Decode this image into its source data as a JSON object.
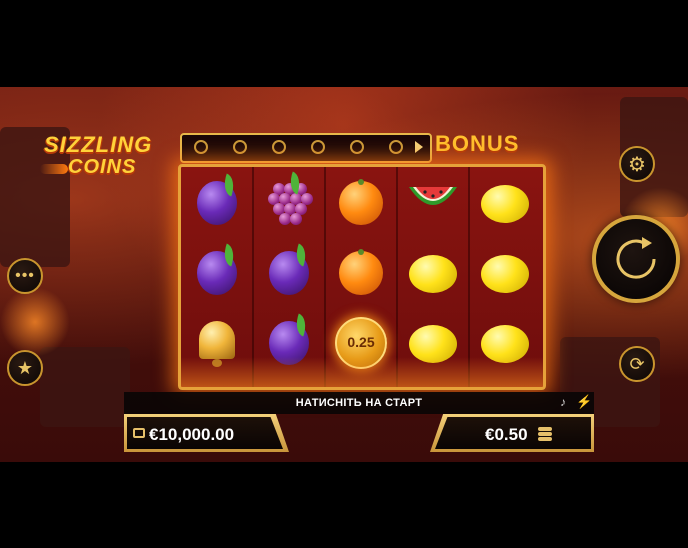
{
  "logo": {
    "line1": "SIZZLING",
    "line2": "COINS"
  },
  "bonus": {
    "label": "BONUS",
    "slots": 6
  },
  "reels": [
    [
      "plum",
      "plum",
      "bell"
    ],
    [
      "grapes",
      "plum",
      "plum"
    ],
    [
      "orange",
      "orange",
      "coin"
    ],
    [
      "watermelon",
      "lemon",
      "lemon"
    ],
    [
      "lemon",
      "lemon",
      "lemon"
    ]
  ],
  "coin_value": "0.25",
  "status": {
    "message": "НАТИСНІТЬ НА СТАРТ"
  },
  "balance": {
    "value": "€10,000.00"
  },
  "bet": {
    "value": "€0.50"
  },
  "icons": {
    "menu": "more-dots-icon",
    "favorite": "star-icon",
    "settings": "gear-icon",
    "spin": "spin-arrow-icon",
    "autoplay": "autoplay-arrows-icon",
    "music": "music-note-icon",
    "turbo": "lightning-icon",
    "balance": "briefcase-icon",
    "bet": "coin-stack-icon"
  },
  "colors": {
    "gold": "#d6a63c",
    "lava": "#6a1b12",
    "logo_yellow": "#ffd23a"
  }
}
